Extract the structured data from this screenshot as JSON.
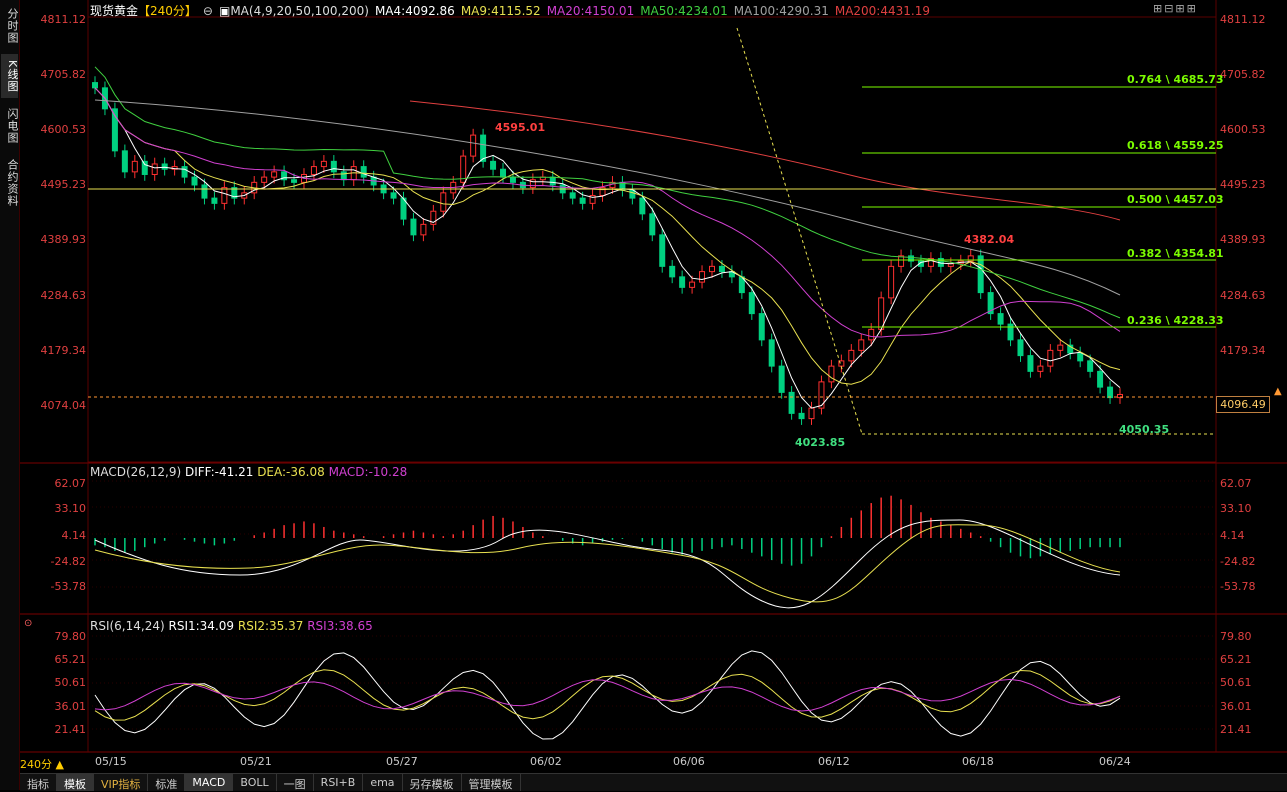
{
  "sidebar": {
    "tabs": [
      "分时图",
      "K线图",
      "闪电图",
      "合约资料"
    ],
    "active": 1
  },
  "header": {
    "symbol": "现货黄金",
    "period": "【240分】",
    "ma_params": "MA(4,9,20,50,100,200)",
    "ma": [
      {
        "label": "MA4:4092.86",
        "color": "#ffffff"
      },
      {
        "label": "MA9:4115.52",
        "color": "#e8e050"
      },
      {
        "label": "MA20:4150.01",
        "color": "#d040d0"
      },
      {
        "label": "MA50:4234.01",
        "color": "#40d040"
      },
      {
        "label": "MA100:4290.31",
        "color": "#a0a0a0"
      },
      {
        "label": "MA200:4431.19",
        "color": "#e04040"
      }
    ],
    "tools": "⊞⊟⊞⊞"
  },
  "price_axis": [
    "4811.12",
    "4705.82",
    "4600.53",
    "4495.23",
    "4389.93",
    "4284.63",
    "4179.34",
    "4074.04"
  ],
  "last_price": "4096.49",
  "annotations": {
    "high1": "4595.01",
    "high2": "4382.04",
    "low1": "4023.85",
    "low2": "4050.35"
  },
  "fib_levels": [
    "0.764 \\ 4685.73",
    "0.618 \\ 4559.25",
    "0.500 \\ 4457.03",
    "0.382 \\ 4354.81",
    "0.236 \\ 4228.33"
  ],
  "macd": {
    "title": "MACD(26,12,9)",
    "diff": "DIFF:-41.21",
    "dea": "DEA:-36.08",
    "macd": "MACD:-10.28",
    "axis": [
      "62.07",
      "33.10",
      "4.14",
      "-24.82",
      "-53.78"
    ]
  },
  "rsi": {
    "title": "RSI(6,14,24)",
    "rsi1": "RSI1:34.09",
    "rsi2": "RSI2:35.37",
    "rsi3": "RSI3:38.65",
    "axis": [
      "79.80",
      "65.21",
      "50.61",
      "36.01",
      "21.41"
    ]
  },
  "x_axis": [
    "05/15",
    "05/21",
    "05/27",
    "06/02",
    "06/06",
    "06/12",
    "06/18",
    "06/24"
  ],
  "period_selector": "240分 ▲",
  "bottom_tabs": [
    "指标",
    "模板",
    "VIP指标",
    "标准",
    "MACD",
    "BOLL",
    "一图",
    "RSI+B",
    "ema",
    "另存模板",
    "管理模板"
  ],
  "colors": {
    "up": "#ff3030",
    "down": "#00d080",
    "ma200": "#e04040",
    "ma100": "#a0a0a0",
    "ma50": "#40d040",
    "ma20": "#d040d0",
    "ma9": "#e8e050",
    "ma4": "#ffffff",
    "fib": "#7CFC00"
  }
}
